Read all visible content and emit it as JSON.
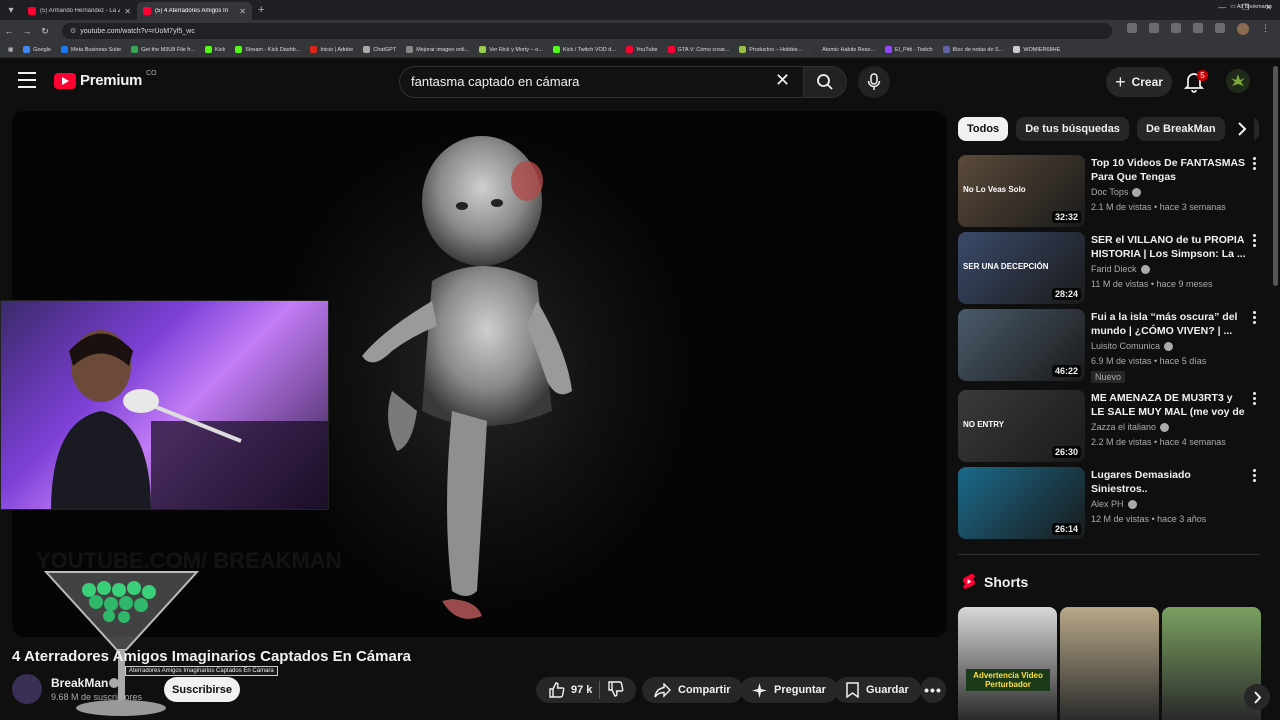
{
  "browser": {
    "tabs": [
      {
        "title": "(5) Armando Hernández - La Ze",
        "active": false
      },
      {
        "title": "(5) 4 Aterradores Amigos In",
        "active": true
      }
    ],
    "url": "youtube.com/watch?v=rUoM7yf5_wc",
    "bookmarks": [
      {
        "label": "Google",
        "color": "#4285f4"
      },
      {
        "label": "Meta Business Suite",
        "color": "#1877f2"
      },
      {
        "label": "Get the M3U8 File fr...",
        "color": "#34a853"
      },
      {
        "label": "Kick",
        "color": "#53fc18"
      },
      {
        "label": "Stream - Kick Dashb...",
        "color": "#53fc18"
      },
      {
        "label": "Inicio | Adobe",
        "color": "#e1251b"
      },
      {
        "label": "ChatGPT",
        "color": "#aaaaaa"
      },
      {
        "label": "Mejorar imagen onli...",
        "color": "#888888"
      },
      {
        "label": "Ver Rick y Morty – o...",
        "color": "#97ce4c"
      },
      {
        "label": "Kick / Twitch VOD d...",
        "color": "#53fc18"
      },
      {
        "label": "YouTube",
        "color": "#ff0033"
      },
      {
        "label": "GTA V: Cómo crear...",
        "color": "#ff0033"
      },
      {
        "label": "Productos – Hobbie...",
        "color": "#96bf48"
      },
      {
        "label": "Atomic Habits Reso...",
        "color": "#333333"
      },
      {
        "label": "El_Pitti - Twitch",
        "color": "#9146ff"
      },
      {
        "label": "Bloc de notas de S...",
        "color": "#6264a7"
      },
      {
        "label": "WOMIER68HE",
        "color": "#cccccc"
      }
    ],
    "all_bookmarks": "All Bookmarks"
  },
  "header": {
    "logo_text": "Premium",
    "country": "CO",
    "search_value": "fantasma captado en cámara",
    "create_label": "Crear",
    "notifications": "5"
  },
  "video": {
    "title": "4 Aterradores Amigos Imaginarios Captados En Cámara",
    "tooltip": "Aterradores Amigos Imaginarios Captados En Cámara",
    "watermark": "YOUTUBE.COM/ BREAKMAN",
    "channel": "BreakMan",
    "subscribers": "9.68 M de suscriptores",
    "subscribe_label": "Suscribirse",
    "likes": "97 k",
    "share_label": "Compartir",
    "ask_label": "Preguntar",
    "save_label": "Guardar"
  },
  "sidebar": {
    "chips": [
      "Todos",
      "De tus búsquedas",
      "De BreakMan",
      "R"
    ],
    "recommendations": [
      {
        "title": "Top 10 Videos De FANTASMAS Para Que Tengas PESADILLAS...",
        "channel": "Doc Tops",
        "meta": "2.1 M de vistas • hace 3 semanas",
        "duration": "32:32",
        "thumb_text": "No Lo Veas Solo",
        "bg": "#5a4a3a",
        "new": ""
      },
      {
        "title": "SER el VILLANO de tu PROPIA HISTORIA | Los Simpson: La ...",
        "channel": "Farid Dieck",
        "meta": "11 M de vistas • hace 9 meses",
        "duration": "28:24",
        "thumb_text": "SER UNA DECEPCIÓN",
        "bg": "#3a4a6a",
        "new": ""
      },
      {
        "title": "Fui a la isla “más oscura” del mundo | ¿CÓMO VIVEN? | ...",
        "channel": "Luisito Comunica",
        "meta": "6.9 M de vistas • hace 5 días",
        "duration": "46:22",
        "thumb_text": "",
        "bg": "#4a5a6a",
        "new": "Nuevo"
      },
      {
        "title": "ME AMENAZA DE MU3RT3 y LE SALE MUY MAL (me voy de all...",
        "channel": "Zazza el italiano",
        "meta": "2.2 M de vistas • hace 4 semanas",
        "duration": "26:30",
        "thumb_text": "NO ENTRY",
        "bg": "#3a3a3a",
        "new": ""
      },
      {
        "title": "Lugares Demasiado Siniestros..",
        "channel": "Alex PH",
        "meta": "12 M de vistas • hace 3 años",
        "duration": "26:14",
        "thumb_text": "",
        "bg": "#1a6a8a",
        "new": ""
      }
    ],
    "shorts_label": "Shorts",
    "shorts": [
      {
        "caption": "Advertencia Video Perturbador",
        "bg": "#d8d8d8"
      },
      {
        "caption": "",
        "bg": "#b8a888"
      },
      {
        "caption": "",
        "bg": "#7aa060"
      }
    ]
  }
}
